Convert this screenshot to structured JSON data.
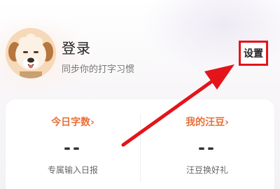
{
  "profile": {
    "login_label": "登录",
    "subtitle": "同步你的打字习惯",
    "avatar_icon": "dog-avatar-icon"
  },
  "settings": {
    "label": "设置",
    "highlight_color": "#e4141b"
  },
  "stats": {
    "today_chars": {
      "title": "今日字数",
      "chevron": "›",
      "value": "--",
      "description": "专属输入日报"
    },
    "my_beans": {
      "title": "我的汪豆",
      "chevron": "›",
      "value": "--",
      "description": "汪豆换好礼"
    }
  },
  "colors": {
    "accent": "#e8703a",
    "annotation_red": "#e4141b"
  }
}
